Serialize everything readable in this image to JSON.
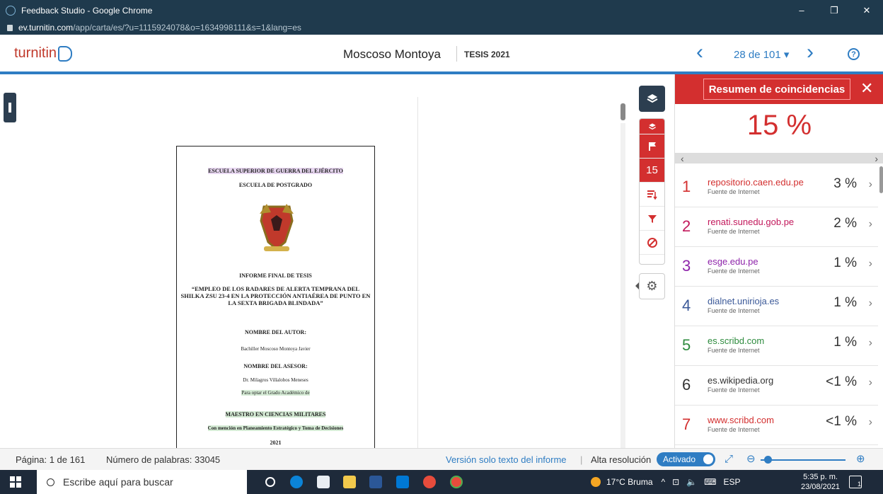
{
  "window": {
    "title": "Feedback Studio - Google Chrome",
    "url_host": "ev.turnitin.com",
    "url_path": "/app/carta/es/?u=1115924078&o=1634998111&s=1&lang=es",
    "min": "–",
    "restore": "❐",
    "close": "✕"
  },
  "header": {
    "logo": "turnitin",
    "doc_title": "Moscoso Montoya",
    "doc_sub": "TESIS 2021",
    "prev": "‹",
    "pager": "28 de 101 ▾",
    "next": "›",
    "help": "?"
  },
  "document": {
    "line1": "ESCUELA SUPERIOR DE GUERRA DEL EJÉRCITO",
    "line2": "ESCUELA DE POSTGRADO",
    "line3": "INFORME FINAL DE TESIS",
    "line4": "“EMPLEO DE LOS RADARES DE ALERTA TEMPRANA DEL SHILKA ZSU 23-4 EN LA PROTECCIÓN ANTIAÉREA DE PUNTO EN LA SEXTA BRIGADA BLINDADA”",
    "line5": "NOMBRE DEL AUTOR:",
    "line6": "Bachiller Moscoso Montoya Javier",
    "line7": "NOMBRE DEL ASESOR:",
    "line8": "Dr. Milagros Villalobos Meneses",
    "line9": "Para optar el Grado Académico de",
    "line10": "MAESTRO EN CIENCIAS MILITARES",
    "line11": "Con mención en Planeamiento Estratégico y Toma de Decisiones",
    "line12": "2021"
  },
  "toolbar": {
    "match_count": "15"
  },
  "panel": {
    "title": "Resumen de coincidencias",
    "close": "✕",
    "percent": "15 %",
    "scroll_left": "‹",
    "scroll_right": "›",
    "matches": [
      {
        "num": "1",
        "source": "repositorio.caen.edu.pe",
        "type": "Fuente de Internet",
        "pct": "3 %",
        "color": "#d32f2f"
      },
      {
        "num": "2",
        "source": "renati.sunedu.gob.pe",
        "type": "Fuente de Internet",
        "pct": "2 %",
        "color": "#c2185b"
      },
      {
        "num": "3",
        "source": "esge.edu.pe",
        "type": "Fuente de Internet",
        "pct": "1 %",
        "color": "#8e24aa"
      },
      {
        "num": "4",
        "source": "dialnet.unirioja.es",
        "type": "Fuente de Internet",
        "pct": "1 %",
        "color": "#3b5998"
      },
      {
        "num": "5",
        "source": "es.scribd.com",
        "type": "Fuente de Internet",
        "pct": "1 %",
        "color": "#2e8b3e"
      },
      {
        "num": "6",
        "source": "es.wikipedia.org",
        "type": "Fuente de Internet",
        "pct": "<1 %",
        "color": "#333333"
      },
      {
        "num": "7",
        "source": "www.scribd.com",
        "type": "Fuente de Internet",
        "pct": "<1 %",
        "color": "#d32f2f"
      }
    ]
  },
  "statusbar": {
    "page": "Página: 1 de 161",
    "words": "Número de palabras: 33045",
    "text_only": "Versión solo texto del informe",
    "sep": "|",
    "hires": "Alta resolución",
    "toggle": "Activado"
  },
  "taskbar": {
    "search": "Escribe aquí para buscar",
    "weather": "17°C  Bruma",
    "lang": "ESP",
    "time": "5:35 p. m.",
    "date": "23/08/2021",
    "notif": "1"
  }
}
